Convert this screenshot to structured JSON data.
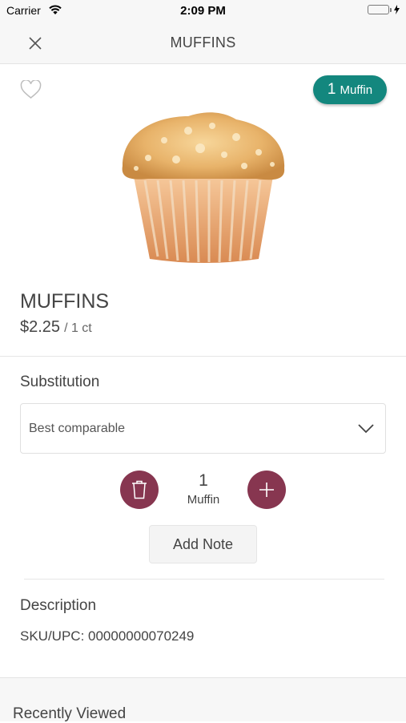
{
  "status_bar": {
    "carrier": "Carrier",
    "time": "2:09 PM",
    "wifi_icon": "wifi-icon",
    "battery_icon": "battery-icon",
    "charging_icon": "bolt-icon"
  },
  "nav": {
    "title": "MUFFINS",
    "close_icon": "close-icon"
  },
  "product": {
    "favorite_icon": "heart-outline-icon",
    "cart_badge": {
      "quantity": "1",
      "unit": "Muffin",
      "color": "#13877e"
    },
    "name": "MUFFINS",
    "price": "$2.25",
    "price_unit": "/ 1 ct"
  },
  "substitution": {
    "heading": "Substitution",
    "selected": "Best comparable",
    "chevron_icon": "chevron-down-icon"
  },
  "quantity": {
    "value": "1",
    "unit": "Muffin",
    "remove_icon": "trash-icon",
    "add_icon": "plus-icon",
    "button_color": "#873650"
  },
  "add_note_label": "Add Note",
  "description": {
    "heading": "Description",
    "sku": "SKU/UPC: 00000000070249"
  },
  "recently_viewed": {
    "heading": "Recently Viewed"
  }
}
